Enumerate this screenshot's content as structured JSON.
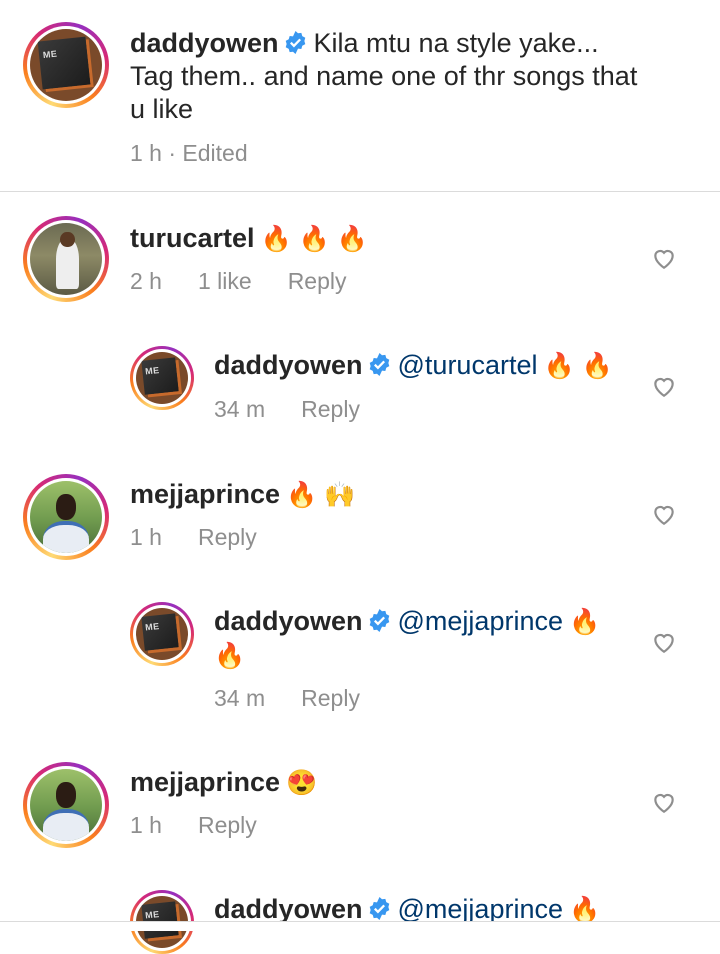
{
  "post": {
    "username": "daddyowen",
    "caption_line1": "Kila mtu na style yake...",
    "caption_line2": "Tag them.. and name one of thr songs that",
    "caption_line3": "u like",
    "meta": "1 h · Edited"
  },
  "comments": [
    {
      "username": "turucartel",
      "text": "",
      "emoji": "🔥 🔥 🔥",
      "time": "2 h",
      "likes": "1 like",
      "reply": "Reply"
    },
    {
      "username": "daddyowen",
      "mention": "@turucartel",
      "emoji": "🔥 🔥",
      "time": "34 m",
      "reply": "Reply"
    },
    {
      "username": "mejjaprince",
      "emoji": "🔥 🙌",
      "time": "1 h",
      "reply": "Reply"
    },
    {
      "username": "daddyowen",
      "mention": "@mejjaprince",
      "emoji": "🔥",
      "emoji2": "🔥",
      "time": "34 m",
      "reply": "Reply"
    },
    {
      "username": "mejjaprince",
      "emoji": "😍",
      "time": "1 h",
      "reply": "Reply"
    },
    {
      "username": "daddyowen",
      "mention": "@mejjaprince",
      "emoji": "🔥"
    }
  ],
  "icons": {
    "verified": "verified-badge-icon",
    "heart": "heart-outline-icon"
  },
  "colors": {
    "verified": "#3897f0",
    "mention": "#00376b",
    "meta": "#8e8e8e"
  }
}
